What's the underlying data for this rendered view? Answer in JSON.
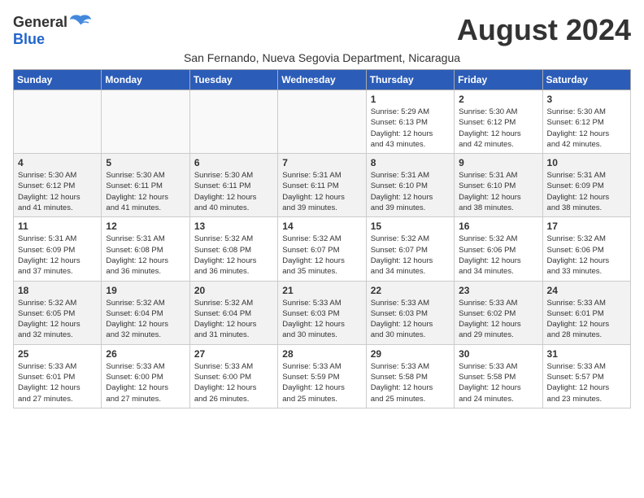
{
  "header": {
    "logo_general": "General",
    "logo_blue": "Blue",
    "month_year": "August 2024",
    "subtitle": "San Fernando, Nueva Segovia Department, Nicaragua"
  },
  "weekdays": [
    "Sunday",
    "Monday",
    "Tuesday",
    "Wednesday",
    "Thursday",
    "Friday",
    "Saturday"
  ],
  "weeks": [
    [
      {
        "day": "",
        "info": ""
      },
      {
        "day": "",
        "info": ""
      },
      {
        "day": "",
        "info": ""
      },
      {
        "day": "",
        "info": ""
      },
      {
        "day": "1",
        "info": "Sunrise: 5:29 AM\nSunset: 6:13 PM\nDaylight: 12 hours\nand 43 minutes."
      },
      {
        "day": "2",
        "info": "Sunrise: 5:30 AM\nSunset: 6:12 PM\nDaylight: 12 hours\nand 42 minutes."
      },
      {
        "day": "3",
        "info": "Sunrise: 5:30 AM\nSunset: 6:12 PM\nDaylight: 12 hours\nand 42 minutes."
      }
    ],
    [
      {
        "day": "4",
        "info": "Sunrise: 5:30 AM\nSunset: 6:12 PM\nDaylight: 12 hours\nand 41 minutes."
      },
      {
        "day": "5",
        "info": "Sunrise: 5:30 AM\nSunset: 6:11 PM\nDaylight: 12 hours\nand 41 minutes."
      },
      {
        "day": "6",
        "info": "Sunrise: 5:30 AM\nSunset: 6:11 PM\nDaylight: 12 hours\nand 40 minutes."
      },
      {
        "day": "7",
        "info": "Sunrise: 5:31 AM\nSunset: 6:11 PM\nDaylight: 12 hours\nand 39 minutes."
      },
      {
        "day": "8",
        "info": "Sunrise: 5:31 AM\nSunset: 6:10 PM\nDaylight: 12 hours\nand 39 minutes."
      },
      {
        "day": "9",
        "info": "Sunrise: 5:31 AM\nSunset: 6:10 PM\nDaylight: 12 hours\nand 38 minutes."
      },
      {
        "day": "10",
        "info": "Sunrise: 5:31 AM\nSunset: 6:09 PM\nDaylight: 12 hours\nand 38 minutes."
      }
    ],
    [
      {
        "day": "11",
        "info": "Sunrise: 5:31 AM\nSunset: 6:09 PM\nDaylight: 12 hours\nand 37 minutes."
      },
      {
        "day": "12",
        "info": "Sunrise: 5:31 AM\nSunset: 6:08 PM\nDaylight: 12 hours\nand 36 minutes."
      },
      {
        "day": "13",
        "info": "Sunrise: 5:32 AM\nSunset: 6:08 PM\nDaylight: 12 hours\nand 36 minutes."
      },
      {
        "day": "14",
        "info": "Sunrise: 5:32 AM\nSunset: 6:07 PM\nDaylight: 12 hours\nand 35 minutes."
      },
      {
        "day": "15",
        "info": "Sunrise: 5:32 AM\nSunset: 6:07 PM\nDaylight: 12 hours\nand 34 minutes."
      },
      {
        "day": "16",
        "info": "Sunrise: 5:32 AM\nSunset: 6:06 PM\nDaylight: 12 hours\nand 34 minutes."
      },
      {
        "day": "17",
        "info": "Sunrise: 5:32 AM\nSunset: 6:06 PM\nDaylight: 12 hours\nand 33 minutes."
      }
    ],
    [
      {
        "day": "18",
        "info": "Sunrise: 5:32 AM\nSunset: 6:05 PM\nDaylight: 12 hours\nand 32 minutes."
      },
      {
        "day": "19",
        "info": "Sunrise: 5:32 AM\nSunset: 6:04 PM\nDaylight: 12 hours\nand 32 minutes."
      },
      {
        "day": "20",
        "info": "Sunrise: 5:32 AM\nSunset: 6:04 PM\nDaylight: 12 hours\nand 31 minutes."
      },
      {
        "day": "21",
        "info": "Sunrise: 5:33 AM\nSunset: 6:03 PM\nDaylight: 12 hours\nand 30 minutes."
      },
      {
        "day": "22",
        "info": "Sunrise: 5:33 AM\nSunset: 6:03 PM\nDaylight: 12 hours\nand 30 minutes."
      },
      {
        "day": "23",
        "info": "Sunrise: 5:33 AM\nSunset: 6:02 PM\nDaylight: 12 hours\nand 29 minutes."
      },
      {
        "day": "24",
        "info": "Sunrise: 5:33 AM\nSunset: 6:01 PM\nDaylight: 12 hours\nand 28 minutes."
      }
    ],
    [
      {
        "day": "25",
        "info": "Sunrise: 5:33 AM\nSunset: 6:01 PM\nDaylight: 12 hours\nand 27 minutes."
      },
      {
        "day": "26",
        "info": "Sunrise: 5:33 AM\nSunset: 6:00 PM\nDaylight: 12 hours\nand 27 minutes."
      },
      {
        "day": "27",
        "info": "Sunrise: 5:33 AM\nSunset: 6:00 PM\nDaylight: 12 hours\nand 26 minutes."
      },
      {
        "day": "28",
        "info": "Sunrise: 5:33 AM\nSunset: 5:59 PM\nDaylight: 12 hours\nand 25 minutes."
      },
      {
        "day": "29",
        "info": "Sunrise: 5:33 AM\nSunset: 5:58 PM\nDaylight: 12 hours\nand 25 minutes."
      },
      {
        "day": "30",
        "info": "Sunrise: 5:33 AM\nSunset: 5:58 PM\nDaylight: 12 hours\nand 24 minutes."
      },
      {
        "day": "31",
        "info": "Sunrise: 5:33 AM\nSunset: 5:57 PM\nDaylight: 12 hours\nand 23 minutes."
      }
    ]
  ]
}
